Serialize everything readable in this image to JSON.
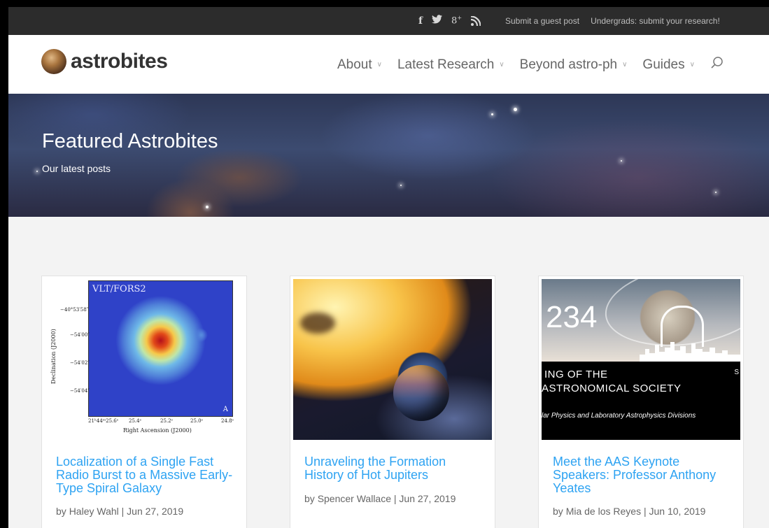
{
  "topbar": {
    "social": [
      {
        "icon": "facebook-icon",
        "glyph": "f"
      },
      {
        "icon": "twitter-icon",
        "glyph": "🐦"
      },
      {
        "icon": "google-plus-icon",
        "glyph": "8⁺"
      },
      {
        "icon": "rss-icon",
        "glyph": ""
      }
    ],
    "links": [
      "Submit a guest post",
      "Undergrads: submit your research!"
    ]
  },
  "header": {
    "logo_text": "astrobites",
    "nav": [
      {
        "label": "About"
      },
      {
        "label": "Latest Research"
      },
      {
        "label": "Beyond astro-ph"
      },
      {
        "label": "Guides"
      }
    ],
    "search_icon": "search-icon"
  },
  "hero": {
    "title": "Featured Astrobites",
    "subtitle": "Our latest posts"
  },
  "cards": [
    {
      "title": "Localization of a Single Fast Radio Burst to a Massive Early-Type Spiral Galaxy",
      "author": "Haley Wahl",
      "date": "Jun 27, 2019",
      "thumb": {
        "label": "VLT/FORS2",
        "corner": "A",
        "ylabel": "Declination (J2000)",
        "xlabel": "Right Ascension (J2000)",
        "yticks": [
          "−40°53′58″",
          "−54′00″",
          "−54′02″",
          "−54′04″"
        ],
        "xticks": [
          "21ʰ44ᵐ25.6ˢ",
          "25.4ˢ",
          "25.2ˢ",
          "25.0ˢ",
          "24.8ˢ"
        ]
      }
    },
    {
      "title": "Unraveling the Formation History of Hot Jupiters",
      "author": "Spencer Wallace",
      "date": "Jun 27, 2019"
    },
    {
      "title": "Meet the AAS Keynote Speakers: Professor Anthony Yeates",
      "author": "Mia de los Reyes",
      "date": "Jun 10, 2019",
      "thumb": {
        "number": "234",
        "line1": "ING OF THE",
        "line2": "ASTRONOMICAL SOCIETY",
        "line3": "lar Physics and Laboratory Astrophysics Divisions",
        "edge": "S"
      }
    }
  ],
  "meta_sep": "|",
  "by_prefix": "by",
  "colors": {
    "link": "#2ea3f2",
    "topbar": "#2c2c2c"
  }
}
